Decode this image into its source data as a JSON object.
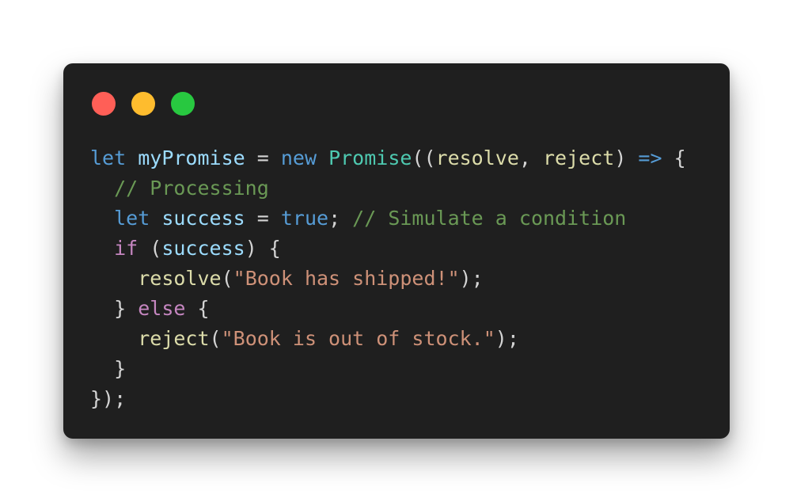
{
  "window": {
    "controls": [
      {
        "name": "close",
        "color": "#ff5f57"
      },
      {
        "name": "minimize",
        "color": "#febc2e"
      },
      {
        "name": "maximize",
        "color": "#28c840"
      }
    ]
  },
  "code": {
    "l1": {
      "t1": "let",
      "t2": " ",
      "t3": "myPromise",
      "t4": " = ",
      "t5": "new",
      "t6": " ",
      "t7": "Promise",
      "t8": "((",
      "t9": "resolve",
      "t10": ", ",
      "t11": "reject",
      "t12": ") ",
      "t13": "=>",
      "t14": " {"
    },
    "l2": {
      "indent": "  ",
      "t1": "// Processing"
    },
    "l3": {
      "indent": "  ",
      "t1": "let",
      "t2": " ",
      "t3": "success",
      "t4": " = ",
      "t5": "true",
      "t6": "; ",
      "t7": "// Simulate a condition"
    },
    "l4": {
      "indent": "  ",
      "t1": "if",
      "t2": " (",
      "t3": "success",
      "t4": ") {"
    },
    "l5": {
      "indent": "    ",
      "t1": "resolve",
      "t2": "(",
      "t3": "\"Book has shipped!\"",
      "t4": ");"
    },
    "l6": {
      "indent": "  ",
      "t1": "} ",
      "t2": "else",
      "t3": " {"
    },
    "l7": {
      "indent": "    ",
      "t1": "reject",
      "t2": "(",
      "t3": "\"Book is out of stock.\"",
      "t4": ");"
    },
    "l8": {
      "indent": "  ",
      "t1": "}"
    },
    "l9": {
      "t1": "});"
    }
  }
}
